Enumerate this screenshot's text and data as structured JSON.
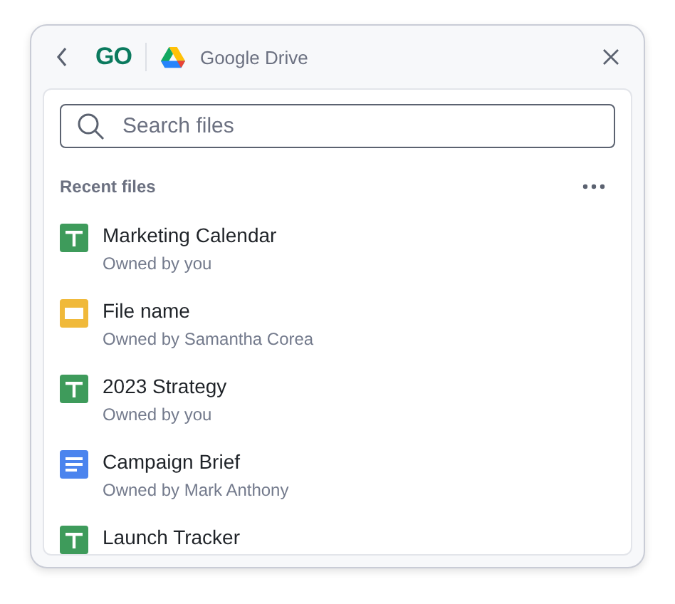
{
  "header": {
    "logo": "GO",
    "service": "Google Drive"
  },
  "search": {
    "placeholder": "Search files"
  },
  "section": {
    "title": "Recent files"
  },
  "files": [
    {
      "kind": "sheet",
      "name": "Marketing Calendar",
      "owner": "Owned by you"
    },
    {
      "kind": "slide",
      "name": "File name",
      "owner": "Owned by Samantha Corea"
    },
    {
      "kind": "sheet",
      "name": "2023 Strategy",
      "owner": "Owned by you"
    },
    {
      "kind": "doc",
      "name": "Campaign Brief",
      "owner": "Owned by Mark Anthony"
    },
    {
      "kind": "sheet",
      "name": "Launch Tracker"
    }
  ]
}
